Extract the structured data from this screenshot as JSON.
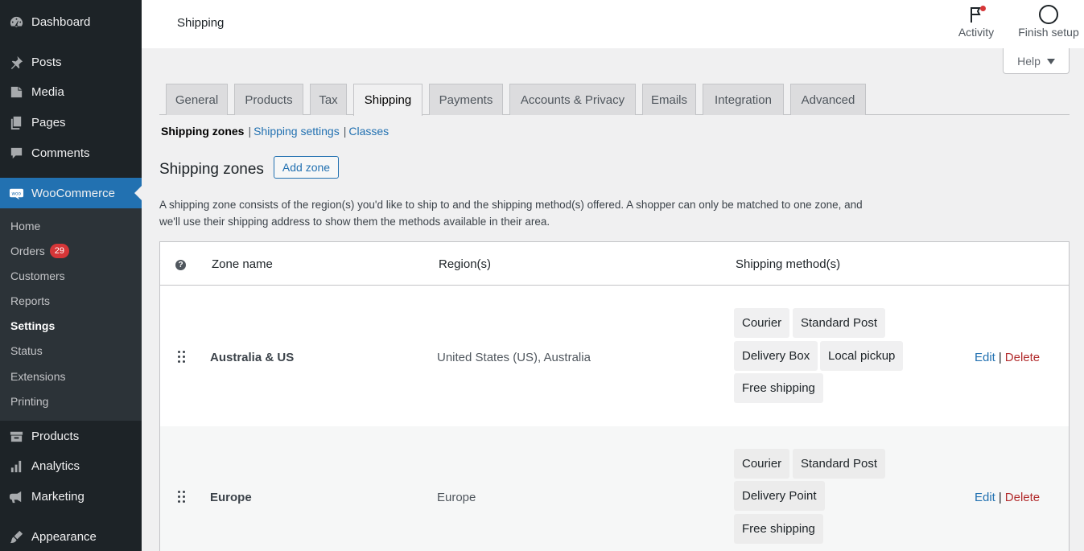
{
  "sidebar": {
    "top_items": [
      {
        "label": "Dashboard",
        "icon": "dashboard-icon"
      },
      {
        "label": "Posts",
        "icon": "pin-icon"
      },
      {
        "label": "Media",
        "icon": "media-icon"
      },
      {
        "label": "Pages",
        "icon": "pages-icon"
      },
      {
        "label": "Comments",
        "icon": "comments-icon"
      }
    ],
    "woocommerce": {
      "label": "WooCommerce",
      "icon": "woo-icon"
    },
    "submenu": [
      {
        "label": "Home"
      },
      {
        "label": "Orders",
        "badge": "29"
      },
      {
        "label": "Customers"
      },
      {
        "label": "Reports"
      },
      {
        "label": "Settings",
        "active": true
      },
      {
        "label": "Status"
      },
      {
        "label": "Extensions"
      },
      {
        "label": "Printing"
      }
    ],
    "bottom_items": [
      {
        "label": "Products",
        "icon": "archive-icon"
      },
      {
        "label": "Analytics",
        "icon": "bar-chart-icon"
      },
      {
        "label": "Marketing",
        "icon": "megaphone-icon"
      },
      {
        "label": "Appearance",
        "icon": "brush-icon"
      }
    ]
  },
  "header": {
    "title": "Shipping",
    "activity_label": "Activity",
    "finish_setup_label": "Finish setup",
    "help_label": "Help"
  },
  "tabs": [
    {
      "label": "General"
    },
    {
      "label": "Products"
    },
    {
      "label": "Tax"
    },
    {
      "label": "Shipping",
      "active": true
    },
    {
      "label": "Payments"
    },
    {
      "label": "Accounts & Privacy"
    },
    {
      "label": "Emails"
    },
    {
      "label": "Integration"
    },
    {
      "label": "Advanced"
    }
  ],
  "subsub": {
    "current": "Shipping zones",
    "links": [
      "Shipping settings",
      "Classes"
    ],
    "separator": "|"
  },
  "zones": {
    "title": "Shipping zones",
    "add_button": "Add zone",
    "description": "A shipping zone consists of the region(s) you'd like to ship to and the shipping method(s) offered. A shopper can only be matched to one zone, and we'll use their shipping address to show them the methods available in their area."
  },
  "table": {
    "help_glyph": "?",
    "headers": {
      "zone_name": "Zone name",
      "regions": "Region(s)",
      "methods": "Shipping method(s)"
    },
    "rows": [
      {
        "zone": "Australia & US",
        "regions": "United States (US), Australia",
        "methods": [
          "Courier",
          "Standard Post",
          "Delivery Box",
          "Local pickup",
          "Free shipping"
        ],
        "edit": "Edit",
        "sep": "|",
        "delete": "Delete"
      },
      {
        "zone": "Europe",
        "regions": "Europe",
        "methods": [
          "Courier",
          "Standard Post",
          "Delivery Point",
          "Free shipping"
        ],
        "edit": "Edit",
        "sep": "|",
        "delete": "Delete"
      }
    ]
  },
  "colors": {
    "accent": "#2271b1",
    "sidebar_bg": "#1d2327",
    "delete": "#b32d2e",
    "badge": "#d63638"
  }
}
